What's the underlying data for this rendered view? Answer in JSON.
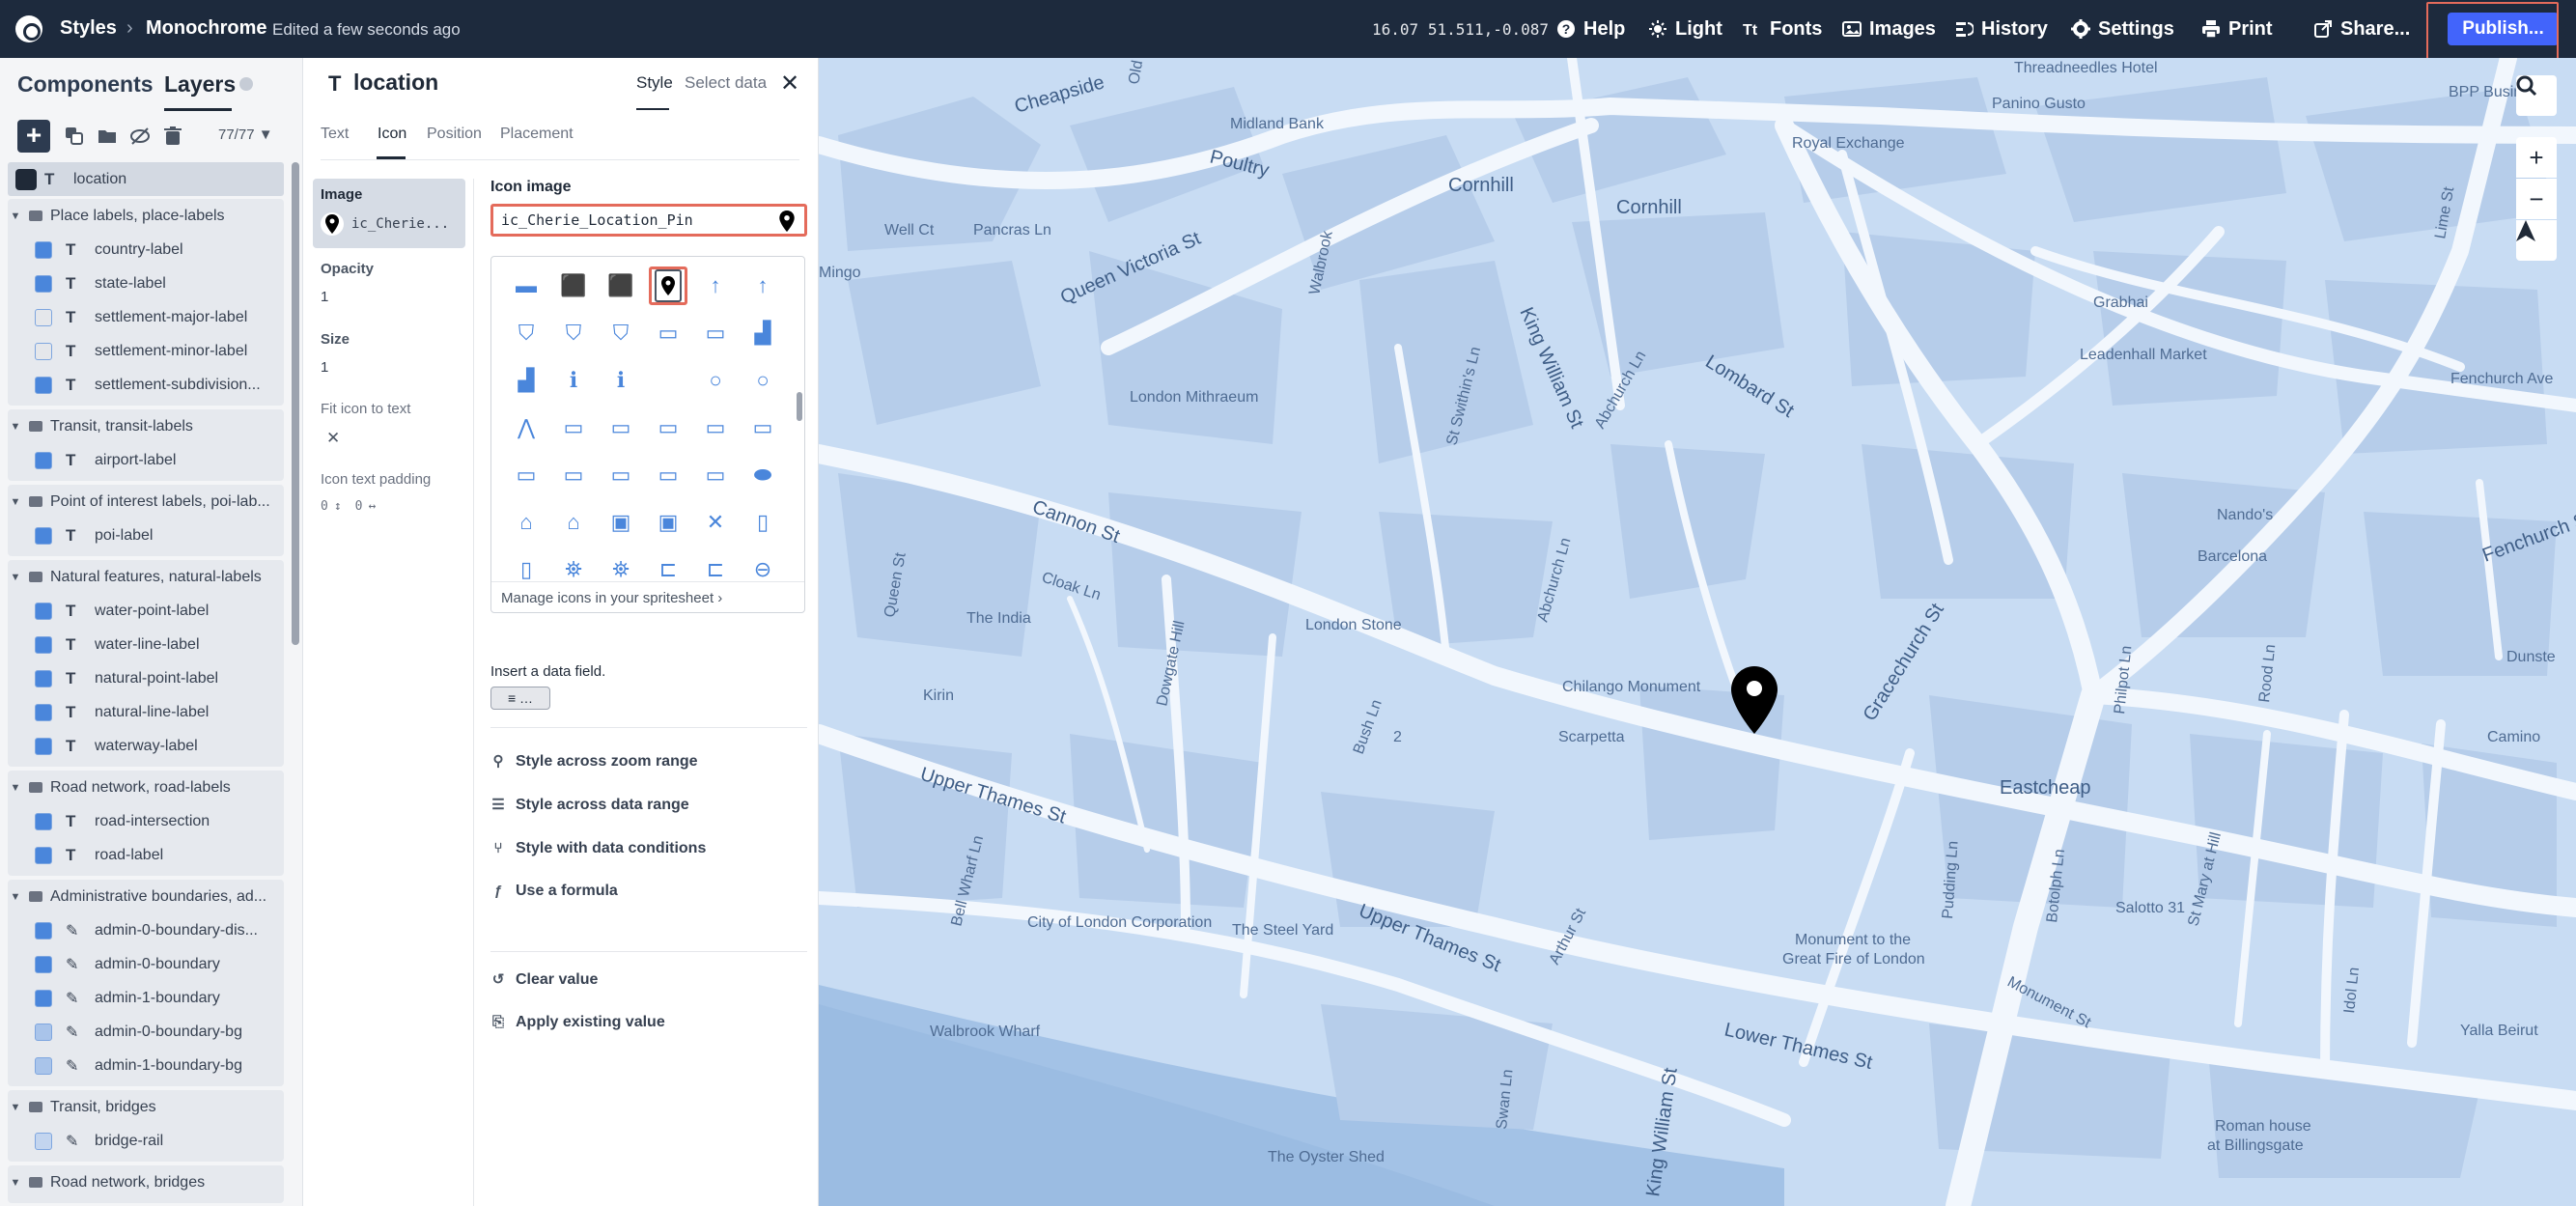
{
  "topbar": {
    "breadcrumb_root": "Styles",
    "breadcrumb_sep": "›",
    "style_name": "Monochrome",
    "edit_status": "Edited a few seconds ago",
    "zoom": "16.07",
    "coords": "51.511,-0.087",
    "buttons": {
      "help": "Help",
      "theme": "Light",
      "fonts": "Fonts",
      "images": "Images",
      "history": "History",
      "settings": "Settings",
      "print": "Print",
      "share": "Share...",
      "publish": "Publish..."
    }
  },
  "left_panel": {
    "tab_components": "Components",
    "tab_layers": "Layers",
    "layer_count": "77/77",
    "selected_layer": "location",
    "groups": [
      {
        "name": "Place labels, place-labels",
        "layers": [
          "country-label",
          "state-label",
          "settlement-major-label",
          "settlement-minor-label",
          "settlement-subdivision..."
        ]
      },
      {
        "name": "Transit, transit-labels",
        "layers": [
          "airport-label"
        ]
      },
      {
        "name": "Point of interest labels, poi-lab...",
        "layers": [
          "poi-label"
        ]
      },
      {
        "name": "Natural features, natural-labels",
        "layers": [
          "water-point-label",
          "water-line-label",
          "natural-point-label",
          "natural-line-label",
          "waterway-label"
        ]
      },
      {
        "name": "Road network, road-labels",
        "layers": [
          "road-intersection",
          "road-label"
        ]
      },
      {
        "name": "Administrative boundaries, ad...",
        "layers": [
          "admin-0-boundary-dis...",
          "admin-0-boundary",
          "admin-1-boundary",
          "admin-0-boundary-bg",
          "admin-1-boundary-bg"
        ]
      },
      {
        "name": "Transit, bridges",
        "layers": [
          "bridge-rail"
        ]
      },
      {
        "name": "Road network, bridges",
        "layers": []
      }
    ]
  },
  "prop_panel": {
    "layer_name": "location",
    "tab_style": "Style",
    "tab_select_data": "Select data",
    "close": "✕",
    "subtabs": [
      "Text",
      "Icon",
      "Position",
      "Placement"
    ],
    "active_subtab": "Icon",
    "properties": {
      "image_label": "Image",
      "image_value": "ic_Cherie...",
      "opacity_label": "Opacity",
      "opacity_value": "1",
      "size_label": "Size",
      "size_value": "1",
      "fit_label": "Fit icon to text",
      "fit_value": "✕",
      "padding_label": "Icon text padding",
      "padding_v": "0",
      "padding_h": "0"
    },
    "icon_image": {
      "label": "Icon image",
      "value": "ic_Cherie_Location_Pin",
      "manage_link": "Manage icons in your spritesheet",
      "insert_label": "Insert a data field.",
      "insert_btn": "…"
    },
    "actions": [
      {
        "icon": "zoom-range-icon",
        "label": "Style across zoom range"
      },
      {
        "icon": "data-range-icon",
        "label": "Style across data range"
      },
      {
        "icon": "data-conditions-icon",
        "label": "Style with data conditions"
      },
      {
        "icon": "formula-icon",
        "label": "Use a formula"
      }
    ],
    "bottom_actions": [
      {
        "icon": "clear-icon",
        "label": "Clear value"
      },
      {
        "icon": "apply-icon",
        "label": "Apply existing value"
      }
    ]
  },
  "map": {
    "labels": {
      "threadneedles": "Threadneedles Hotel",
      "panino": "Panino Gusto",
      "bpp": "BPP Business",
      "midland": "Midland Bank",
      "royal_exchange": "Royal Exchange",
      "cornhill1": "Cornhill",
      "cornhill2": "Cornhill",
      "cheapside": "Cheapside",
      "poultry": "Poultry",
      "well_ct": "Well Ct",
      "pancras": "Pancras Ln",
      "queen_victoria": "Queen Victoria St",
      "walbrook": "Walbrook",
      "mingo": "Mingo",
      "grabhai": "Grabhai",
      "leadenhall": "Leadenhall Market",
      "lime": "Lime St",
      "fenchurch_ave": "Fenchurch Ave",
      "london_mithraeum": "London Mithraeum",
      "king_william1": "King William St",
      "st_swithins": "St Swithin's Ln",
      "abchurch1": "Abchurch Ln",
      "lombard": "Lombard St",
      "cannon": "Cannon St",
      "cloak": "Cloak Ln",
      "queen_st": "Queen St",
      "the_india": "The India",
      "dowgate": "Dowgate Hill",
      "london_stone": "London Stone",
      "abchurch2": "Abchurch Ln",
      "chilango": "Chilango Monument",
      "gracechurch": "Gracechurch St",
      "nandos": "Nando's",
      "barcelona": "Barcelona",
      "fenchurch_st": "Fenchurch St",
      "kirin": "Kirin",
      "bush": "Bush Ln",
      "two": "2",
      "scarpetta": "Scarpetta",
      "philpot": "Philpot Ln",
      "rood": "Rood Ln",
      "dunster": "Dunste",
      "camino": "Camino",
      "eastcheap": "Eastcheap",
      "upper_thames1": "Upper Thames St",
      "bell_wharf": "Bell Wharf Ln",
      "pudding": "Pudding Ln",
      "botolph": "Botolph Ln",
      "salotto": "Salotto 31",
      "st_mary": "St Mary at Hill",
      "city_of_london": "City of London Corporation",
      "steel_yard": "The Steel Yard",
      "upper_thames2": "Upper Thames St",
      "arthur": "Arthur St",
      "monument1": "Monument to the",
      "monument2": "Great Fire of London",
      "idol": "Idol Ln",
      "monument_st": "Monument St",
      "walbrook_wharf": "Walbrook Wharf",
      "yalla": "Yalla Beirut",
      "lower_thames": "Lower Thames St",
      "king_william2": "King William St",
      "swan": "Swan Ln",
      "roman1": "Roman house",
      "roman2": "at Billingsgate",
      "oyster": "The Oyster Shed",
      "old": "Old"
    },
    "controls": {
      "search": "search-icon",
      "zoom_in": "+",
      "zoom_out": "−",
      "north": "compass-icon"
    },
    "colors": {
      "land": "#c8dcf3",
      "road": "#f2f7fd",
      "building": "#b6cdea",
      "water": "#a3c2e6",
      "pin": "#000000",
      "accent": "#4264fb",
      "highlight": "#e46b5b"
    }
  }
}
